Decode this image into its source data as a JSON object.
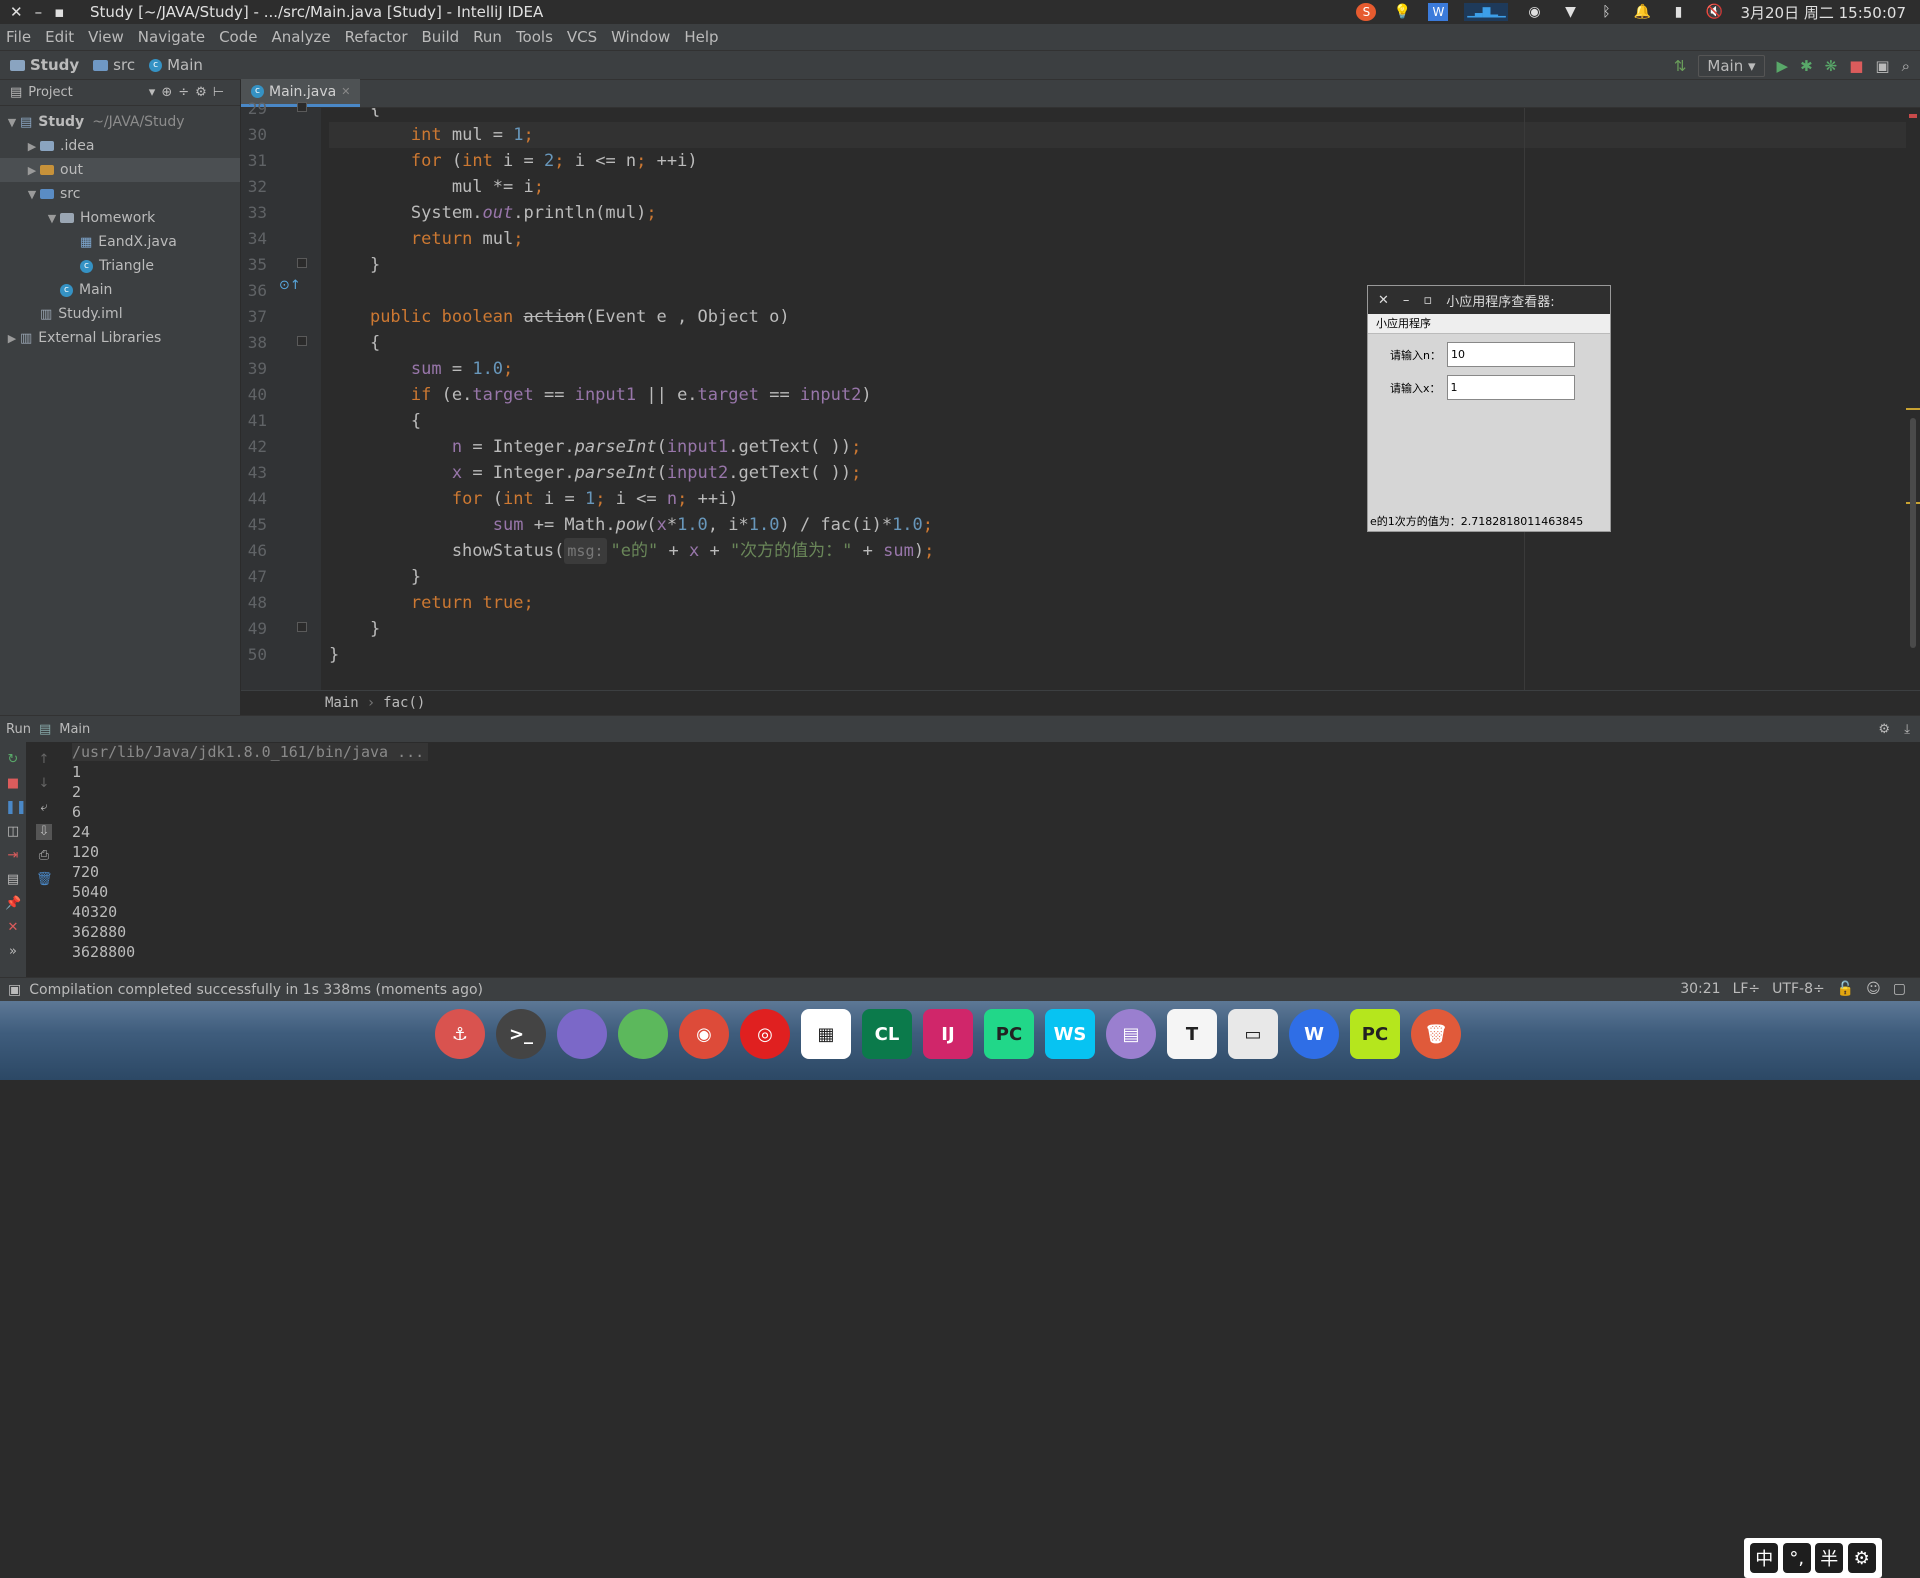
{
  "sysbar": {
    "title": "Study [~/JAVA/Study] - .../src/Main.java [Study] - IntelliJ IDEA",
    "date": "3月20日 周二 15:50:07",
    "tray_icons": [
      "sogou-icon",
      "bulb-icon",
      "wps-icon",
      "cpu-graph-icon",
      "messages-icon",
      "wifi-icon",
      "bluetooth-icon",
      "bell-icon",
      "battery-icon",
      "mute-icon"
    ]
  },
  "menu": [
    "File",
    "Edit",
    "View",
    "Navigate",
    "Code",
    "Analyze",
    "Refactor",
    "Build",
    "Run",
    "Tools",
    "VCS",
    "Window",
    "Help"
  ],
  "nav": {
    "crumbs": [
      "Study",
      "src",
      "Main"
    ],
    "run_config": "Main"
  },
  "project": {
    "header": "Project",
    "tree": [
      {
        "label": "Study",
        "extra": "~/JAVA/Study",
        "indent": 0,
        "arrow": "▼",
        "type": "module"
      },
      {
        "label": ".idea",
        "indent": 1,
        "arrow": "▶",
        "type": "folder"
      },
      {
        "label": "out",
        "indent": 1,
        "arrow": "▶",
        "type": "folder-orange"
      },
      {
        "label": "src",
        "indent": 1,
        "arrow": "▼",
        "type": "folder-blue"
      },
      {
        "label": "Homework",
        "indent": 2,
        "arrow": "▼",
        "type": "package"
      },
      {
        "label": "EandX.java",
        "indent": 3,
        "arrow": "",
        "type": "java"
      },
      {
        "label": "Triangle",
        "indent": 3,
        "arrow": "",
        "type": "class"
      },
      {
        "label": "Main",
        "indent": 2,
        "arrow": "",
        "type": "class"
      },
      {
        "label": "Study.iml",
        "indent": 1,
        "arrow": "",
        "type": "iml"
      },
      {
        "label": "External Libraries",
        "indent": 0,
        "arrow": "▶",
        "type": "lib"
      }
    ]
  },
  "editor": {
    "tab": "Main.java",
    "breadcrumb": [
      "Main",
      "fac()"
    ],
    "line_numbers": [
      "29",
      "30",
      "31",
      "32",
      "33",
      "34",
      "35",
      "36",
      "37",
      "38",
      "39",
      "40",
      "41",
      "42",
      "43",
      "44",
      "45",
      "46",
      "47",
      "48",
      "49",
      "50"
    ],
    "lines": [
      [
        [
          "p",
          "    {"
        ]
      ],
      [
        [
          "p",
          "        "
        ],
        [
          "kw",
          "int"
        ],
        [
          "p",
          " mul = "
        ],
        [
          "num",
          "1"
        ],
        [
          "kw",
          ";"
        ]
      ],
      [
        [
          "p",
          "        "
        ],
        [
          "kw",
          "for"
        ],
        [
          "p",
          " ("
        ],
        [
          "kw",
          "int"
        ],
        [
          "p",
          " i = "
        ],
        [
          "num",
          "2"
        ],
        [
          "kw",
          ";"
        ],
        [
          "p",
          " i <= n"
        ],
        [
          "kw",
          ";"
        ],
        [
          "p",
          " ++i)"
        ]
      ],
      [
        [
          "p",
          "            mul *= i"
        ],
        [
          "kw",
          ";"
        ]
      ],
      [
        [
          "p",
          "        System."
        ],
        [
          "fldi",
          "out"
        ],
        [
          "p",
          ".println(mul)"
        ],
        [
          "kw",
          ";"
        ]
      ],
      [
        [
          "p",
          "        "
        ],
        [
          "kw",
          "return"
        ],
        [
          "p",
          " mul"
        ],
        [
          "kw",
          ";"
        ]
      ],
      [
        [
          "p",
          "    }"
        ]
      ],
      [
        [
          "p",
          ""
        ]
      ],
      [
        [
          "p",
          "    "
        ],
        [
          "kw",
          "public boolean "
        ],
        [
          "dep",
          "action"
        ],
        [
          "p",
          "(Event e , Object o)"
        ]
      ],
      [
        [
          "p",
          "    {"
        ]
      ],
      [
        [
          "p",
          "        "
        ],
        [
          "fld",
          "sum"
        ],
        [
          "p",
          " = "
        ],
        [
          "num",
          "1.0"
        ],
        [
          "kw",
          ";"
        ]
      ],
      [
        [
          "p",
          "        "
        ],
        [
          "kw",
          "if"
        ],
        [
          "p",
          " (e."
        ],
        [
          "fld",
          "target"
        ],
        [
          "p",
          " == "
        ],
        [
          "fld",
          "input1"
        ],
        [
          "p",
          " || e."
        ],
        [
          "fld",
          "target"
        ],
        [
          "p",
          " == "
        ],
        [
          "fld",
          "input2"
        ],
        [
          "p",
          ")"
        ]
      ],
      [
        [
          "p",
          "        {"
        ]
      ],
      [
        [
          "p",
          "            "
        ],
        [
          "fld",
          "n"
        ],
        [
          "p",
          " = Integer."
        ],
        [
          "ital",
          "parseInt"
        ],
        [
          "p",
          "("
        ],
        [
          "fld",
          "input1"
        ],
        [
          "p",
          ".getText( ))"
        ],
        [
          "kw",
          ";"
        ]
      ],
      [
        [
          "p",
          "            "
        ],
        [
          "fld",
          "x"
        ],
        [
          "p",
          " = Integer."
        ],
        [
          "ital",
          "parseInt"
        ],
        [
          "p",
          "("
        ],
        [
          "fld",
          "input2"
        ],
        [
          "p",
          ".getText( ))"
        ],
        [
          "kw",
          ";"
        ]
      ],
      [
        [
          "p",
          "            "
        ],
        [
          "kw",
          "for"
        ],
        [
          "p",
          " ("
        ],
        [
          "kw",
          "int"
        ],
        [
          "p",
          " i = "
        ],
        [
          "num",
          "1"
        ],
        [
          "kw",
          ";"
        ],
        [
          "p",
          " i <= "
        ],
        [
          "fld",
          "n"
        ],
        [
          "kw",
          ";"
        ],
        [
          "p",
          " ++i)"
        ]
      ],
      [
        [
          "p",
          "                "
        ],
        [
          "fld",
          "sum"
        ],
        [
          "p",
          " += Math."
        ],
        [
          "ital",
          "pow"
        ],
        [
          "p",
          "("
        ],
        [
          "fld",
          "x"
        ],
        [
          "p",
          "*"
        ],
        [
          "num",
          "1.0"
        ],
        [
          "p",
          ", i*"
        ],
        [
          "num",
          "1.0"
        ],
        [
          "p",
          ") / fac(i)*"
        ],
        [
          "num",
          "1.0"
        ],
        [
          "kw",
          ";"
        ]
      ],
      [
        [
          "p",
          "            showStatus("
        ],
        [
          "hint",
          "msg:"
        ],
        [
          "str",
          "\"e的\""
        ],
        [
          "p",
          " + "
        ],
        [
          "fld",
          "x"
        ],
        [
          "p",
          " + "
        ],
        [
          "str",
          "\"次方的值为：\""
        ],
        [
          "p",
          " + "
        ],
        [
          "fld",
          "sum"
        ],
        [
          "p",
          ")"
        ],
        [
          "kw",
          ";"
        ]
      ],
      [
        [
          "p",
          "        }"
        ]
      ],
      [
        [
          "p",
          "        "
        ],
        [
          "kw",
          "return true;"
        ]
      ],
      [
        [
          "p",
          "    }"
        ]
      ],
      [
        [
          "p",
          "}"
        ]
      ]
    ]
  },
  "applet": {
    "title": "小应用程序查看器: ",
    "menu": "小应用程序",
    "label_n": "请输入n：",
    "value_n": "10",
    "label_x": "请输入x：",
    "value_x": "1",
    "status": "e的1次方的值为：2.7182818011463845"
  },
  "run": {
    "tab_label": "Run",
    "config": "Main",
    "command": "/usr/lib/Java/jdk1.8.0_161/bin/java ...",
    "output": [
      "1",
      "2",
      "6",
      "24",
      "120",
      "720",
      "5040",
      "40320",
      "362880",
      "3628800"
    ]
  },
  "ime": [
    "中",
    "°,",
    "半",
    "⚙"
  ],
  "status": {
    "message": "Compilation completed successfully in 1s 338ms (moments ago)",
    "position": "30:21",
    "line_sep": "LF÷",
    "encoding": "UTF-8÷"
  },
  "dock": [
    {
      "name": "anchor-icon",
      "label": "⚓",
      "color": "#d9534f"
    },
    {
      "name": "terminal-icon",
      "label": ">_",
      "color": "#444444"
    },
    {
      "name": "purple-app-icon",
      "label": "",
      "color": "#7b68c8"
    },
    {
      "name": "toggle-app-icon",
      "label": "",
      "color": "#5cb85c"
    },
    {
      "name": "chrome-icon",
      "label": "◉",
      "color": "#dd4b39"
    },
    {
      "name": "netease-music-icon",
      "label": "◎",
      "color": "#e02020"
    },
    {
      "name": "windows-store-icon",
      "label": "▦",
      "color": "#ffffff"
    },
    {
      "name": "clion-icon",
      "label": "CL",
      "color": "#0b7a4b"
    },
    {
      "name": "intellij-icon",
      "label": "IJ",
      "color": "#d0266a"
    },
    {
      "name": "pycharm-icon",
      "label": "PC",
      "color": "#21d789"
    },
    {
      "name": "webstorm-icon",
      "label": "WS",
      "color": "#07c3f2"
    },
    {
      "name": "document-viewer-icon",
      "label": "▤",
      "color": "#9a7fcf"
    },
    {
      "name": "typora-icon",
      "label": "T",
      "color": "#f5f5f5"
    },
    {
      "name": "remote-desktop-icon",
      "label": "▭",
      "color": "#e8e8e8"
    },
    {
      "name": "wps-writer-icon",
      "label": "W",
      "color": "#2f6ee6"
    },
    {
      "name": "pycharm-pro-icon",
      "label": "PC",
      "color": "#b5e61d"
    },
    {
      "name": "trash-icon",
      "label": "🗑",
      "color": "#e05a3a"
    }
  ]
}
